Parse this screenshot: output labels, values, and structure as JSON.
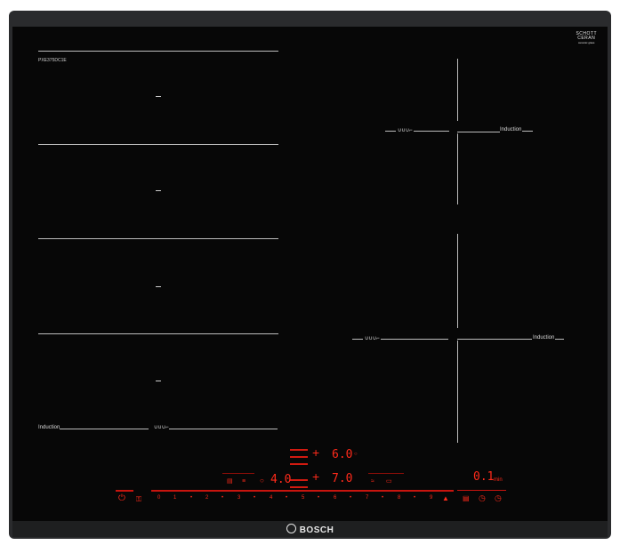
{
  "model_code": "PXE375DC1E",
  "zone_label": "Induction",
  "flex_label": "∪∪∪⌐",
  "logo": {
    "schott_line1": "SCHOTT",
    "schott_line2": "CERAN",
    "schott_small": "ceramic glass"
  },
  "brand": "BOSCH",
  "display": {
    "upper_value": "6.0",
    "lower_value": "7.0",
    "left_value": "4.0",
    "timer_value": "0.1",
    "timer_unit": "min"
  },
  "scale": [
    "0",
    "1",
    "•",
    "2",
    "•",
    "3",
    "•",
    "4",
    "•",
    "5",
    "•",
    "6",
    "•",
    "7",
    "•",
    "8",
    "•",
    "9"
  ],
  "colors": {
    "glass": "#070707",
    "frame": "#2a2b2d",
    "display_red": "#ff2a1a"
  }
}
